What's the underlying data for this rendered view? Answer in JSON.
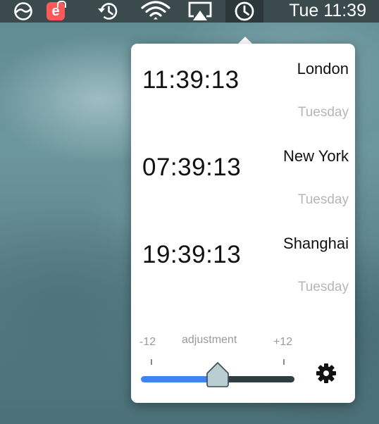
{
  "menubar": {
    "clock_text": "Tue 11:39",
    "icons": [
      "circle-half-icon",
      "e-badge-lock-icon",
      "time-machine-icon",
      "wifi-icon",
      "airplay-icon",
      "clock-icon"
    ]
  },
  "popover": {
    "zones": [
      {
        "time": "11:39:13",
        "city": "London",
        "day": "Tuesday"
      },
      {
        "time": "07:39:13",
        "city": "New York",
        "day": "Tuesday"
      },
      {
        "time": "19:39:13",
        "city": "Shanghai",
        "day": "Tuesday"
      }
    ],
    "adjustment": {
      "label": "adjustment",
      "min_label": "-12",
      "max_label": "+12",
      "min": -12,
      "max": 12,
      "value": 0
    },
    "settings_icon": "gear-icon"
  },
  "colors": {
    "menubar_bg": "#3b4a4d",
    "slider_accent": "#3d85f6",
    "slider_track": "#2f3e42",
    "day_text": "#b6b6b6",
    "e_badge": "#ff5a5a"
  },
  "badge": {
    "letter": "e"
  }
}
